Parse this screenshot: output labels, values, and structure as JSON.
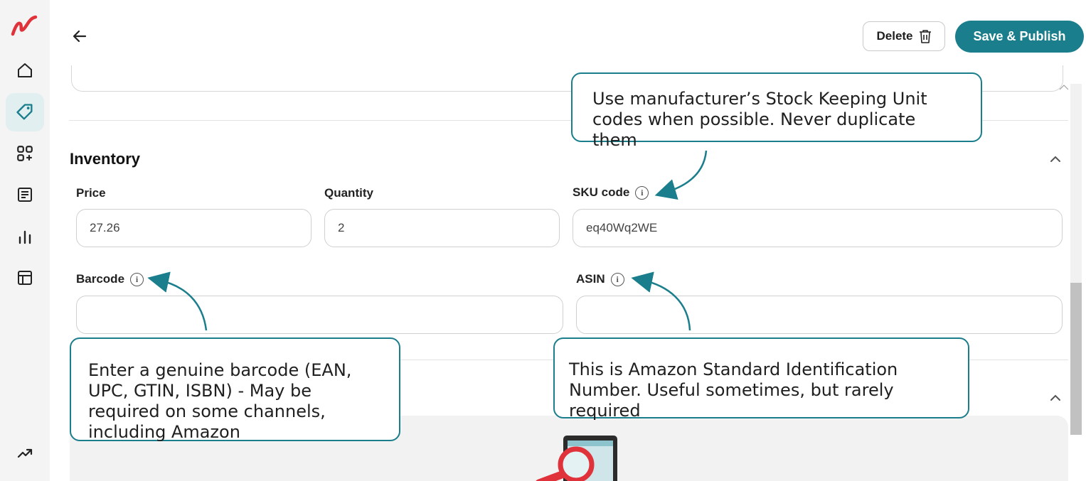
{
  "sidebar": {
    "items": [
      {
        "name": "home-icon"
      },
      {
        "name": "tag-icon",
        "active": true
      },
      {
        "name": "apps-add-icon"
      },
      {
        "name": "document-icon"
      },
      {
        "name": "bar-chart-icon"
      },
      {
        "name": "layout-icon"
      },
      {
        "name": "trending-up-icon"
      }
    ]
  },
  "header": {
    "delete_label": "Delete",
    "publish_label": "Save & Publish"
  },
  "inventory": {
    "title": "Inventory",
    "price_label": "Price",
    "price_value": "27.26",
    "quantity_label": "Quantity",
    "quantity_value": "2",
    "sku_label": "SKU code",
    "sku_value": "eq40Wq2WE",
    "barcode_label": "Barcode",
    "barcode_value": "",
    "asin_label": "ASIN",
    "asin_value": ""
  },
  "callouts": {
    "sku": "Use manufacturer’s Stock Keeping Unit codes when possible. Never duplicate them",
    "barcode": "Enter a genuine barcode (EAN, UPC, GTIN, ISBN) - May be required on some channels, including Amazon",
    "asin": "This is Amazon Standard Identification Number. Useful sometimes, but rarely required"
  },
  "colors": {
    "accent": "#1a7e8c",
    "logo": "#e0323a",
    "active_nav_bg": "#e1eff1"
  }
}
